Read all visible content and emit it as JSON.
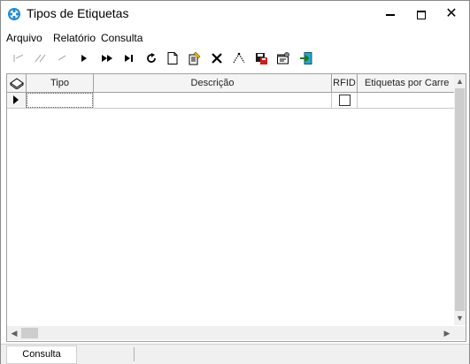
{
  "window": {
    "title": "Tipos de Etiquetas",
    "controls": {
      "minimize": "minimize",
      "maximize": "maximize",
      "close": "✕"
    }
  },
  "menu": [
    {
      "label": "Arquivo"
    },
    {
      "label": "Relatório"
    },
    {
      "label": "Consulta"
    }
  ],
  "toolbar": {
    "buttons": [
      {
        "name": "first-record-icon",
        "glyph": "|‹",
        "enabled": false
      },
      {
        "name": "prev-page-icon",
        "glyph": "‹‹",
        "enabled": false
      },
      {
        "name": "prev-record-icon",
        "glyph": "‹",
        "enabled": false
      },
      {
        "name": "next-record-icon",
        "glyph": "▶",
        "enabled": true
      },
      {
        "name": "next-page-icon",
        "glyph": "▶▶",
        "enabled": true
      },
      {
        "name": "last-record-icon",
        "glyph": "▶|",
        "enabled": true
      },
      {
        "name": "refresh-icon",
        "glyph": "↻",
        "enabled": true
      },
      {
        "name": "new-document-icon",
        "glyph": "new",
        "enabled": true
      },
      {
        "name": "edit-icon",
        "glyph": "edit",
        "enabled": true
      },
      {
        "name": "delete-icon",
        "glyph": "✕",
        "enabled": true
      },
      {
        "name": "filter-icon",
        "glyph": "filter",
        "enabled": true
      },
      {
        "name": "save-icon",
        "glyph": "save",
        "enabled": true
      },
      {
        "name": "properties-icon",
        "glyph": "props",
        "enabled": true
      },
      {
        "name": "exit-icon",
        "glyph": "exit",
        "enabled": true
      }
    ]
  },
  "grid": {
    "columns": [
      "Tipo",
      "Descrição",
      "RFID",
      "Etiquetas por Carre"
    ],
    "rows": [
      {
        "tipo": "",
        "descricao": "",
        "rfid": false,
        "etiquetas": ""
      }
    ]
  },
  "statusbar": {
    "panel1": "Consulta"
  },
  "colors": {
    "header_bg": "#f4f4f4",
    "scroll_bg": "#f0f0f0",
    "icon_blue": "#1e8ad6"
  }
}
